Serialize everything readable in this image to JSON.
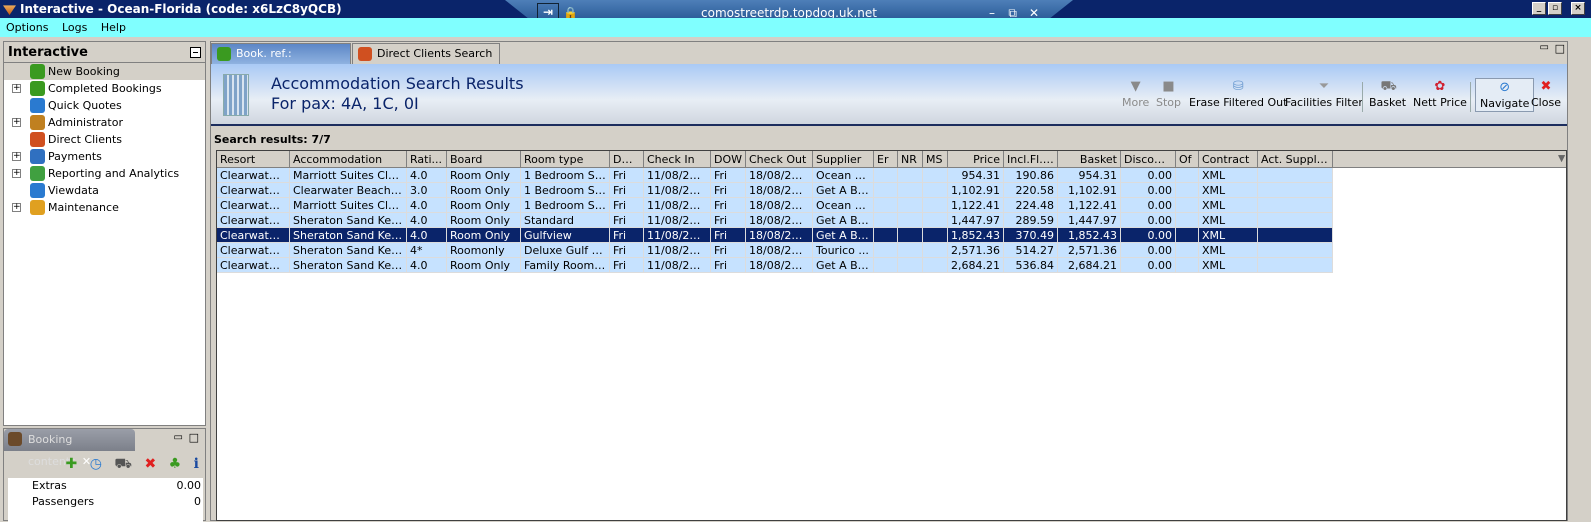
{
  "window": {
    "title": "Interactive - Ocean-Florida (code: x6LzC8yQCB)",
    "rdp_host": "comostreetrdp.topdog.uk.net"
  },
  "menu": [
    "Options",
    "Logs",
    "Help"
  ],
  "sidebar": {
    "title": "Interactive",
    "items": [
      {
        "label": "New Booking",
        "expandable": false,
        "color": "#3a9a20"
      },
      {
        "label": "Completed Bookings",
        "expandable": true,
        "color": "#3a9a20"
      },
      {
        "label": "Quick Quotes",
        "expandable": false,
        "color": "#2a7ad0"
      },
      {
        "label": "Administrator",
        "expandable": true,
        "color": "#c08020"
      },
      {
        "label": "Direct Clients",
        "expandable": false,
        "color": "#d05020"
      },
      {
        "label": "Payments",
        "expandable": true,
        "color": "#3070c0"
      },
      {
        "label": "Reporting and Analytics",
        "expandable": true,
        "color": "#40a040"
      },
      {
        "label": "Viewdata",
        "expandable": false,
        "color": "#2a7ad0"
      },
      {
        "label": "Maintenance",
        "expandable": true,
        "color": "#e0a020"
      }
    ]
  },
  "booking_contents": {
    "title": "Booking contents",
    "rows": [
      {
        "label": "Extras",
        "value": "0.00"
      },
      {
        "label": "Passengers",
        "value": "0"
      }
    ]
  },
  "tabs": [
    {
      "label": "Book. ref.: <none>"
    },
    {
      "label": "Direct Clients Search"
    }
  ],
  "header": {
    "title": "Accommodation Search Results",
    "subtitle": "For pax: 4A, 1C, 0I"
  },
  "toolbar": {
    "more": "More",
    "stop": "Stop",
    "erase": "Erase Filtered Out",
    "facilities": "Facilities Filter",
    "basket": "Basket",
    "nett": "Nett Price",
    "navigate": "Navigate",
    "close": "Close"
  },
  "search_results_label": "Search results: 7/7",
  "table": {
    "columns": [
      "Resort",
      "Accommodation",
      "Rati...",
      "Board",
      "Room type",
      "DOW",
      "Check In",
      "DOW",
      "Check Out",
      "Supplier",
      "Er",
      "NR",
      "MS",
      "Price",
      "Incl.Fl.PP",
      "Basket",
      "Discount",
      "Of",
      "Contract",
      "Act. Supplier"
    ],
    "selected_row": 4,
    "rows": [
      [
        "Clearwater ...",
        "Marriott Suites Clear...",
        "4.0",
        "Room Only",
        "1 Bedroom Suite",
        "Fri",
        "11/08/2017",
        "Fri",
        "18/08/2017",
        "Ocean B...",
        "",
        "",
        "",
        "954.31",
        "190.86",
        "954.31",
        "0.00",
        "",
        "XML",
        ""
      ],
      [
        "Clearwater ...",
        "Clearwater Beach Ma...",
        "3.0",
        "Room Only",
        "1 Bedroom Suit...",
        "Fri",
        "11/08/2017",
        "Fri",
        "18/08/2017",
        "Get A Bed",
        "",
        "",
        "",
        "1,102.91",
        "220.58",
        "1,102.91",
        "0.00",
        "",
        "XML",
        ""
      ],
      [
        "Clearwater ...",
        "Marriott Suites Clear...",
        "4.0",
        "Room Only",
        "1 Bedroom Suit...",
        "Fri",
        "11/08/2017",
        "Fri",
        "18/08/2017",
        "Ocean B...",
        "",
        "",
        "",
        "1,122.41",
        "224.48",
        "1,122.41",
        "0.00",
        "",
        "XML",
        ""
      ],
      [
        "Clearwater ...",
        "Sheraton Sand Key R...",
        "4.0",
        "Room Only",
        "Standard",
        "Fri",
        "11/08/2017",
        "Fri",
        "18/08/2017",
        "Get A Bed",
        "",
        "",
        "",
        "1,447.97",
        "289.59",
        "1,447.97",
        "0.00",
        "",
        "XML",
        ""
      ],
      [
        "Clearwater ...",
        "Sheraton Sand Key R...",
        "4.0",
        "Room Only",
        "Gulfview",
        "Fri",
        "11/08/2017",
        "Fri",
        "18/08/2017",
        "Get A Bed",
        "",
        "",
        "",
        "1,852.43",
        "370.49",
        "1,852.43",
        "0.00",
        "",
        "XML",
        ""
      ],
      [
        "Clearwater ...",
        "Sheraton Sand Key R...",
        "4*",
        "Roomonly",
        "Deluxe Gulf Vie...",
        "Fri",
        "11/08/2017",
        "Fri",
        "18/08/2017",
        "Tourico ...",
        "",
        "",
        "",
        "2,571.36",
        "514.27",
        "2,571.36",
        "0.00",
        "",
        "XML",
        ""
      ],
      [
        "Clearwater ...",
        "Sheraton Sand Key R...",
        "4.0",
        "Room Only",
        "Family Room D...",
        "Fri",
        "11/08/2017",
        "Fri",
        "18/08/2017",
        "Get A Bed",
        "",
        "",
        "",
        "2,684.21",
        "536.84",
        "2,684.21",
        "0.00",
        "",
        "XML",
        ""
      ]
    ]
  }
}
